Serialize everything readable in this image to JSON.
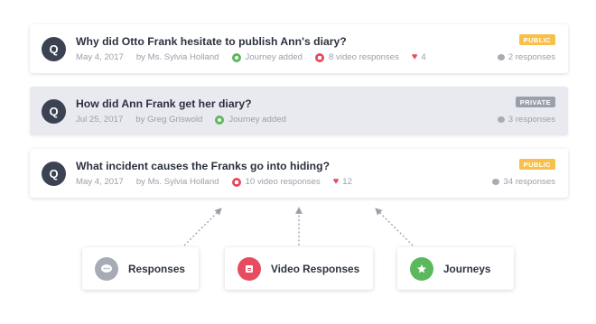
{
  "questions": [
    {
      "avatar": "Q",
      "title": "Why did Otto Frank hesitate to publish Ann's diary?",
      "date": "May 4, 2017",
      "author": "by Ms. Sylvia Holland",
      "journey": "Journey added",
      "videos": "8 video responses",
      "likes": "4",
      "badge": "PUBLIC",
      "responses": "2 responses"
    },
    {
      "avatar": "Q",
      "title": "How did Ann Frank get her diary?",
      "date": "Jul 25, 2017",
      "author": "by Greg Griswold",
      "journey": "Journey added",
      "badge": "PRIVATE",
      "responses": "3 responses"
    },
    {
      "avatar": "Q",
      "title": "What incident causes the Franks go into hiding?",
      "date": "May 4, 2017",
      "author": "by Ms. Sylvia Holland",
      "videos": "10 video responses",
      "likes": "12",
      "badge": "PUBLIC",
      "responses": "34 responses"
    }
  ],
  "legend": {
    "responses": "Responses",
    "video_responses": "Video Responses",
    "journeys": "Journeys"
  },
  "colors": {
    "public_badge": "#f7c04a",
    "private_badge": "#9aa0aa",
    "journey_green": "#5cb85c",
    "video_red": "#e84a5f",
    "responses_gray": "#a6abb4"
  },
  "icons": {
    "avatar": "question-avatar",
    "journey": "journey-icon",
    "video": "video-icon",
    "like": "heart-icon",
    "responses": "chat-bubble-icon",
    "journeys_legend": "star-icon"
  }
}
